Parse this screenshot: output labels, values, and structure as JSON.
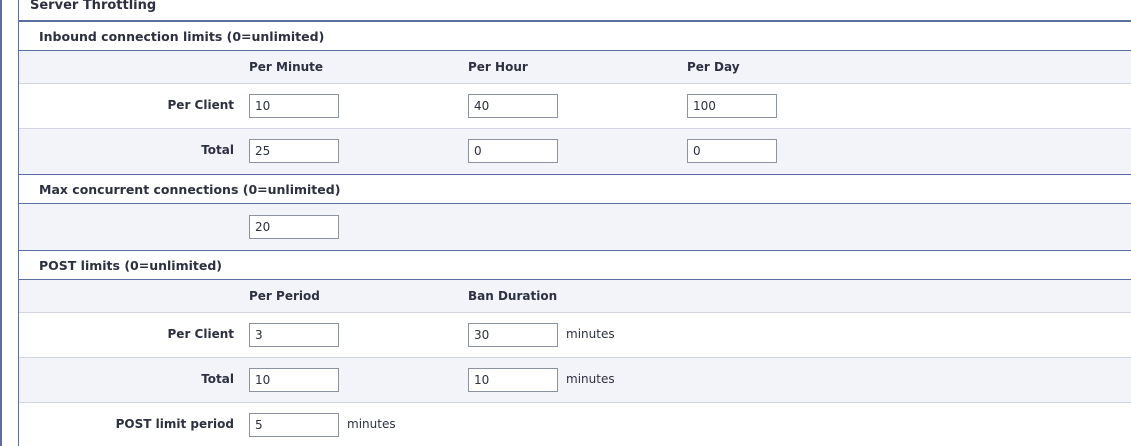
{
  "section_title": "Server Throttling",
  "inbound": {
    "heading": "Inbound connection limits (0=unlimited)",
    "columns": [
      "Per Minute",
      "Per Hour",
      "Per Day"
    ],
    "rows": [
      {
        "label": "Per Client",
        "values": [
          "10",
          "40",
          "100"
        ]
      },
      {
        "label": "Total",
        "values": [
          "25",
          "0",
          "0"
        ]
      }
    ]
  },
  "concurrent": {
    "heading": "Max concurrent connections (0=unlimited)",
    "value": "20"
  },
  "post": {
    "heading": "POST limits (0=unlimited)",
    "columns": [
      "Per Period",
      "Ban Duration"
    ],
    "rows": [
      {
        "label": "Per Client",
        "period": "3",
        "ban": "30",
        "unit": "minutes"
      },
      {
        "label": "Total",
        "period": "10",
        "ban": "10",
        "unit": "minutes"
      }
    ],
    "limit_period": {
      "label": "POST limit period",
      "value": "5",
      "unit": "minutes"
    }
  }
}
